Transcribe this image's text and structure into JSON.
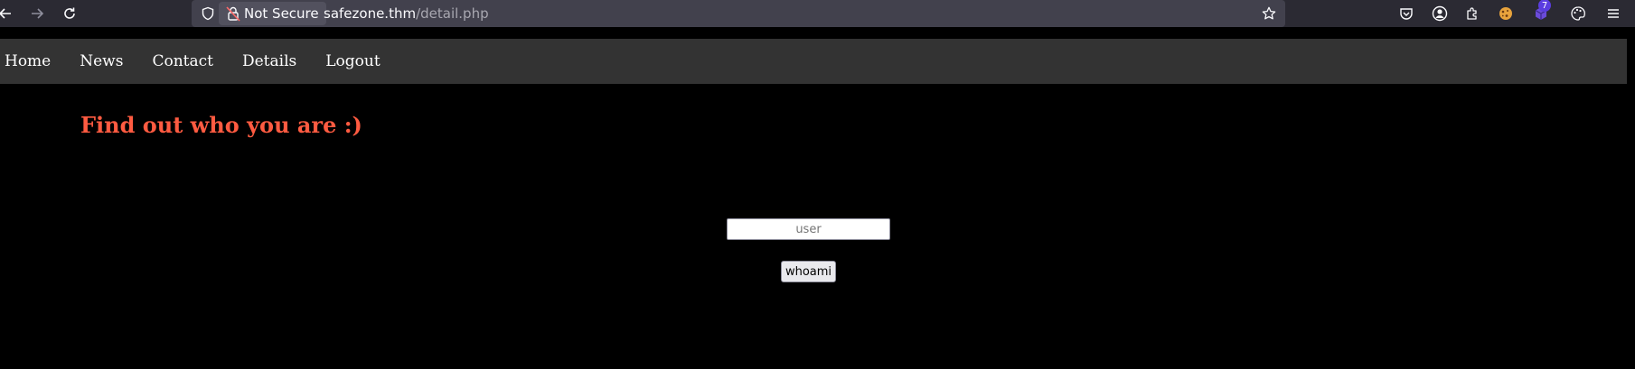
{
  "browser": {
    "security_label": "Not Secure",
    "url_host": "safezone.thm",
    "url_path": "/detail.php",
    "extension_badge": "7",
    "icons": {
      "back": "back-arrow-icon",
      "forward": "forward-arrow-icon",
      "reload": "reload-icon",
      "shield": "tracking-protection-shield-icon",
      "lock": "insecure-lock-icon",
      "bookmark": "bookmark-star-icon",
      "pocket": "pocket-icon",
      "account": "account-icon",
      "extensions": "extensions-icon",
      "menu": "hamburger-menu-icon"
    }
  },
  "nav": {
    "items": [
      {
        "label": "Home"
      },
      {
        "label": "News"
      },
      {
        "label": "Contact"
      },
      {
        "label": "Details"
      },
      {
        "label": "Logout"
      }
    ]
  },
  "main": {
    "heading": "Find out who you are :)",
    "user_input": {
      "value": "",
      "placeholder": "user"
    },
    "submit_label": "whoami"
  },
  "colors": {
    "page_background": "#000000",
    "nav_background": "#333333",
    "heading": "#ff5b41",
    "chrome_background": "#2b2a33",
    "urlbar_background": "#42414d"
  }
}
